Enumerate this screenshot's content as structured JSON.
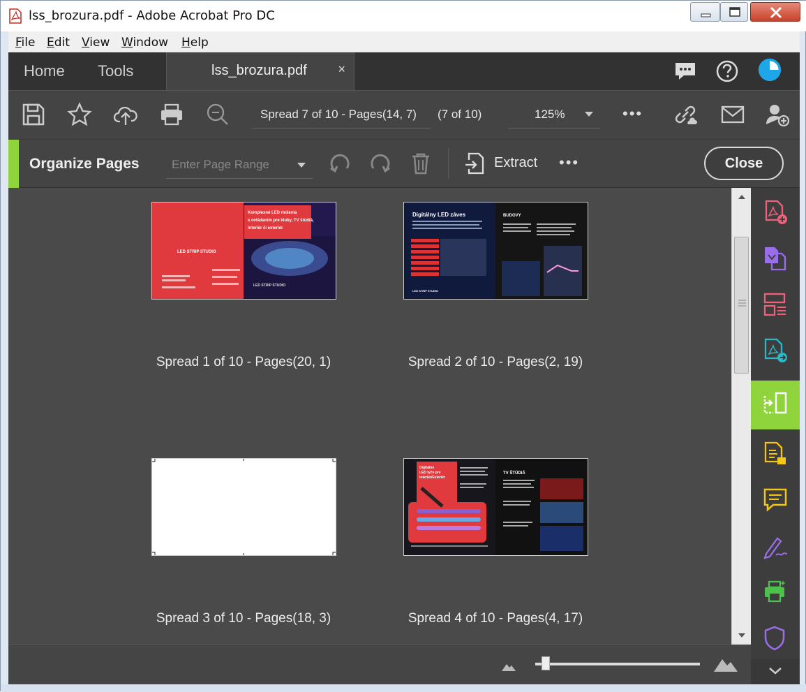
{
  "window": {
    "title": "lss_brozura.pdf - Adobe Acrobat Pro DC"
  },
  "menu": [
    "File",
    "Edit",
    "View",
    "Window",
    "Help"
  ],
  "tabs": {
    "home": "Home",
    "tools": "Tools",
    "document": "lss_brozura.pdf",
    "close_symbol": "×"
  },
  "toolbar": {
    "page_display": "Spread 7 of 10 - Pages(14, 7)",
    "page_count": "(7 of 10)",
    "zoom": "125%",
    "more": "•••"
  },
  "organize": {
    "title": "Organize Pages",
    "range_placeholder": "Enter Page Range",
    "extract_label": "Extract",
    "more": "•••",
    "close_label": "Close"
  },
  "spreads": [
    {
      "caption": "Spread 1 of 10 - Pages(20, 1)"
    },
    {
      "caption": "Spread 2 of 10 - Pages(2, 19)"
    },
    {
      "caption": "Spread 3 of 10 - Pages(18, 3)"
    },
    {
      "caption": "Spread 4 of 10 - Pages(4, 17)"
    }
  ],
  "thumb_text": {
    "s1_headline": "Komplexné LED riešenia s ovládaním pre kluby, TV štúdiá, interiér či exteriér",
    "s1_logo": "LED STRIP STUDIO",
    "s2_left_title": "Digitálny LED záves",
    "s2_right_title": "BUDOVY",
    "s4_left_title": "Digitálne LED tyče pre Interiér/Exteriér",
    "s4_right_title": "TV ŠTÚDIÁ"
  },
  "zoom_slider": {
    "value": 0.1
  },
  "colors": {
    "accent_green": "#8fd43c",
    "brand_red": "#e03a3e",
    "panel_dark": "#444444",
    "canvas": "#4a4a4a"
  },
  "rail_icons": [
    "create-pdf-icon",
    "combine-files-icon",
    "organize-pages-icon",
    "export-pdf-icon",
    "organize-pages-active-icon",
    "edit-pdf-icon",
    "comment-icon",
    "fill-sign-icon",
    "print-production-icon",
    "protect-icon"
  ]
}
